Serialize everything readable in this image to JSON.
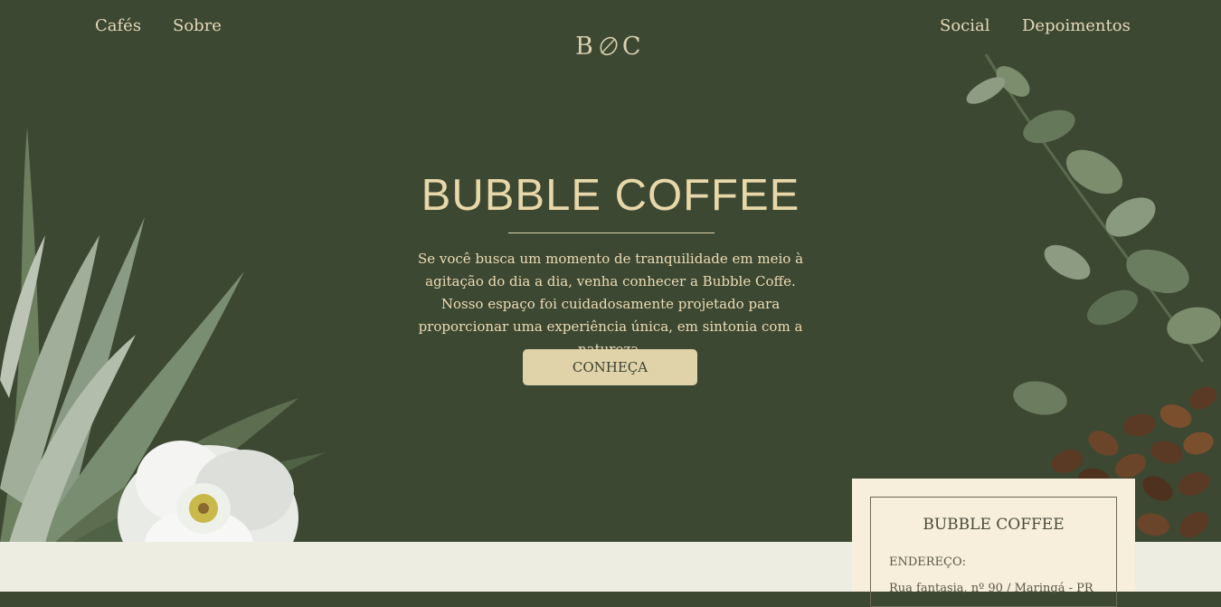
{
  "nav": {
    "left": [
      "Cafés",
      "Sobre"
    ],
    "right": [
      "Social",
      "Depoimentos"
    ]
  },
  "logo": {
    "left_letter": "B",
    "right_letter": "C",
    "icon": "leaf-icon"
  },
  "hero": {
    "title": "BUBBLE COFFEE",
    "description": "Se você busca um momento de tranquilidade em meio à agitação do dia a dia, venha conhecer a Bubble Coffe. Nosso espaço foi cuidadosamente projetado para proporcionar uma experiência única, em sintonia com a natureza.",
    "cta_label": "CONHEÇA"
  },
  "card": {
    "title": "BUBBLE COFFEE",
    "address_label": "ENDEREÇO:",
    "address": "Rua fantasia, nº 90 / Maringá - PR"
  },
  "colors": {
    "background": "#3d4832",
    "accent": "#e0d2a9",
    "title": "#e7d7a9",
    "band": "#edede2",
    "card": "#f7eedb"
  }
}
